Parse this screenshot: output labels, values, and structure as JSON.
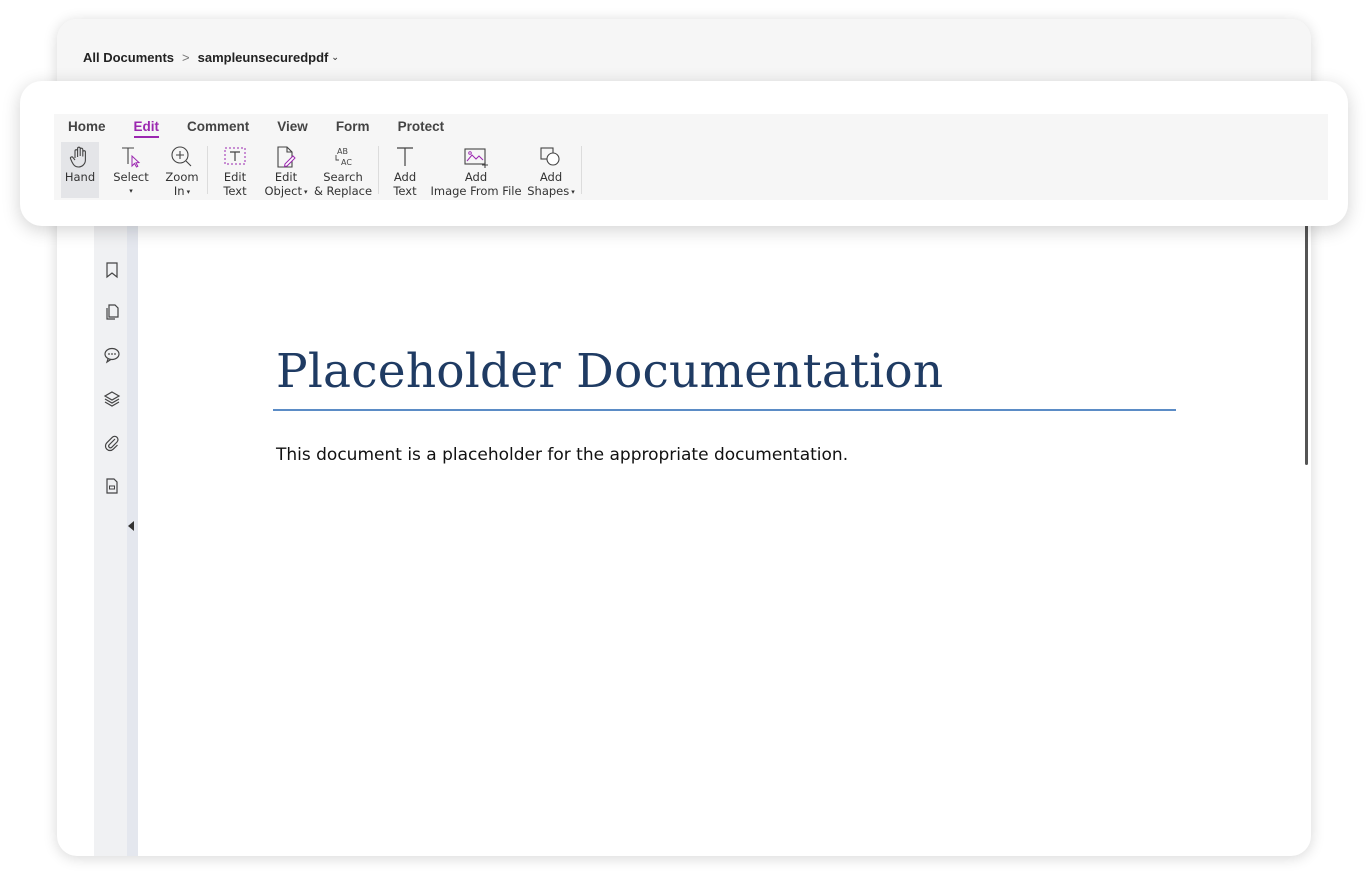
{
  "breadcrumb": {
    "root": "All Documents",
    "separator": ">",
    "current": "sampleunsecuredpdf",
    "chevron": "⌄"
  },
  "tabs": [
    {
      "label": "Home",
      "active": false
    },
    {
      "label": "Edit",
      "active": true
    },
    {
      "label": "Comment",
      "active": false
    },
    {
      "label": "View",
      "active": false
    },
    {
      "label": "Form",
      "active": false
    },
    {
      "label": "Protect",
      "active": false
    }
  ],
  "tools": {
    "hand": {
      "line1": "Hand",
      "line2": "",
      "icon": "hand-icon"
    },
    "select": {
      "line1": "Select",
      "line2": "▾",
      "icon": "select-text-cursor-icon"
    },
    "zoom_in": {
      "line1": "Zoom",
      "line2": "In",
      "dropdown": "▾",
      "icon": "zoom-in-icon"
    },
    "edit_text": {
      "line1": "Edit",
      "line2": "Text",
      "icon": "edit-text-icon"
    },
    "edit_object": {
      "line1": "Edit",
      "line2": "Object",
      "dropdown": "▾",
      "icon": "edit-object-icon"
    },
    "search_replace": {
      "line1": "Search",
      "line2": "& Replace",
      "icon": "search-replace-icon"
    },
    "add_text": {
      "line1": "Add",
      "line2": "Text",
      "icon": "add-text-icon"
    },
    "add_image": {
      "line1": "Add",
      "line2": "Image From File",
      "icon": "add-image-icon"
    },
    "add_shapes": {
      "line1": "Add",
      "line2": "Shapes",
      "dropdown": "▾",
      "icon": "add-shapes-icon"
    }
  },
  "sidebar": [
    {
      "icon": "bookmark-icon"
    },
    {
      "icon": "pages-icon"
    },
    {
      "icon": "comments-icon"
    },
    {
      "icon": "layers-icon"
    },
    {
      "icon": "attachment-icon"
    },
    {
      "icon": "form-fields-icon"
    }
  ],
  "document": {
    "title": "Placeholder Documentation",
    "body": "This document is a placeholder for the appropriate documentation."
  },
  "colors": {
    "accent": "#9b27b0",
    "title": "#1f3b63",
    "rule": "#5b8cc6"
  }
}
